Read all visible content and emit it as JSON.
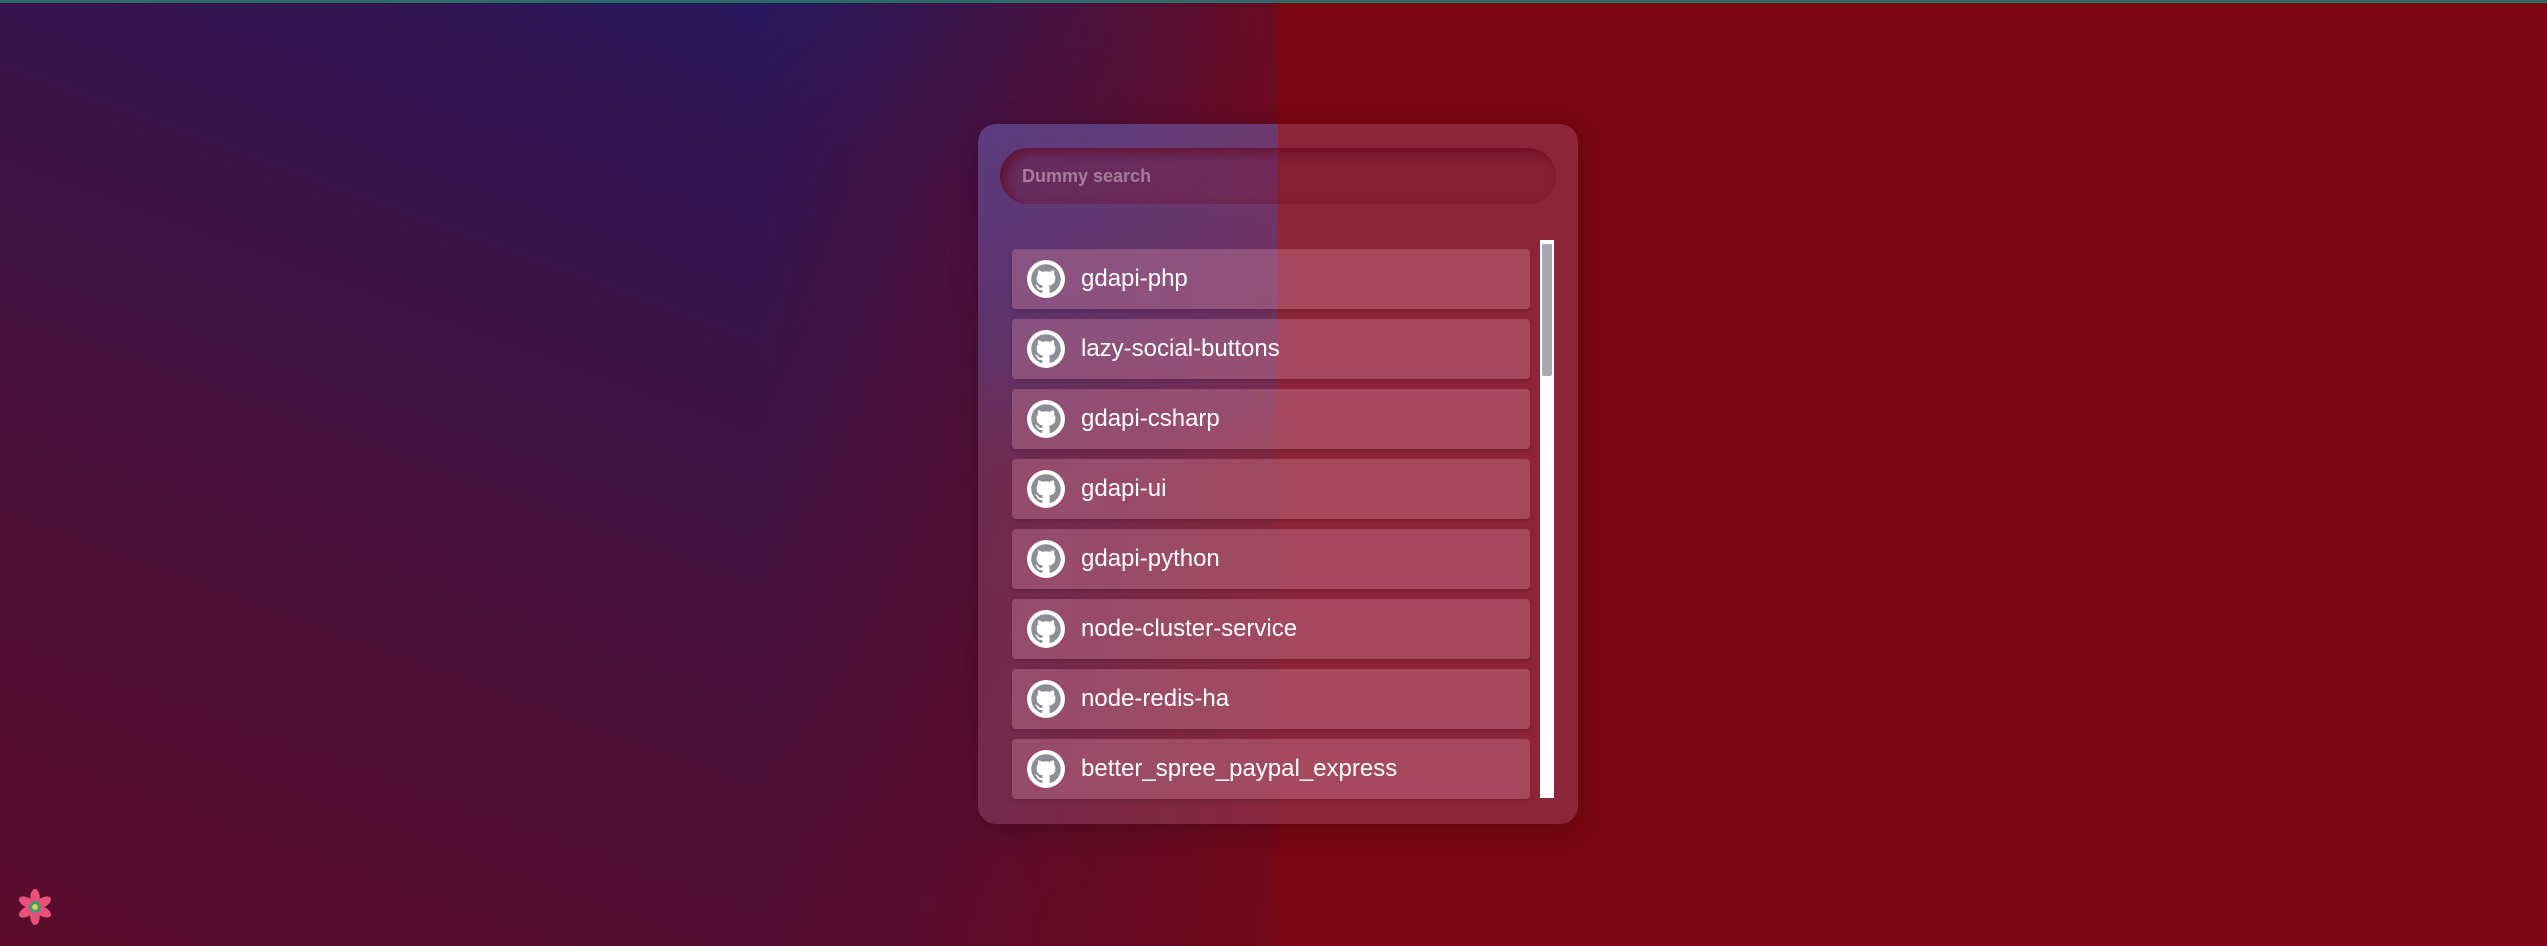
{
  "search": {
    "placeholder": "Dummy search"
  },
  "repos": [
    {
      "name": "gdapi-php",
      "icon": "github-icon"
    },
    {
      "name": "lazy-social-buttons",
      "icon": "github-icon"
    },
    {
      "name": "gdapi-csharp",
      "icon": "github-icon"
    },
    {
      "name": "gdapi-ui",
      "icon": "github-icon"
    },
    {
      "name": "gdapi-python",
      "icon": "github-icon"
    },
    {
      "name": "node-cluster-service",
      "icon": "github-icon"
    },
    {
      "name": "node-redis-ha",
      "icon": "github-icon"
    },
    {
      "name": "better_spree_paypal_express",
      "icon": "github-icon"
    }
  ],
  "logo": {
    "icon": "flower-logo-icon"
  },
  "colors": {
    "background_right": "#7a0612",
    "background_left_top": "#15206e",
    "background_left_bottom": "#5c0c2a",
    "item_text": "#ffffff",
    "avatar": "#ffffff"
  }
}
